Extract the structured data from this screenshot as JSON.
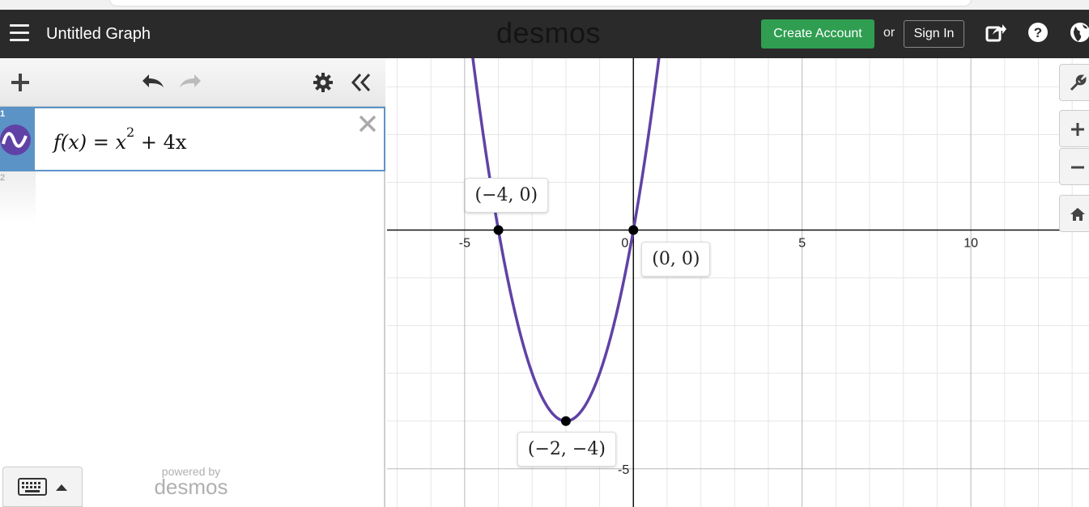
{
  "header": {
    "graph_title": "Untitled Graph",
    "brand": "desmos",
    "create_account_label": "Create Account",
    "or_label": "or",
    "sign_in_label": "Sign In"
  },
  "expressions": [
    {
      "index": "1",
      "latex_parts": {
        "lhs": "f(x) = x",
        "exponent": "2",
        "rhs": "+ 4x"
      },
      "color": "#6042a6"
    },
    {
      "index": "2"
    }
  ],
  "footer": {
    "powered_by": "powered by",
    "brand": "desmos"
  },
  "graph": {
    "curve_color": "#6042a6",
    "x_ticks": [
      "-5",
      "0",
      "5",
      "10"
    ],
    "y_ticks": [
      "-5"
    ],
    "point_labels": [
      "(−4, 0)",
      "(0, 0)",
      "(−2, −4)"
    ]
  },
  "chart_data": {
    "type": "line",
    "title": "",
    "xlabel": "",
    "ylabel": "",
    "function": "x^2 + 4x",
    "xlim": [
      -7.3,
      13.5
    ],
    "ylim": [
      -5.8,
      3.6
    ],
    "grid": true,
    "points": [
      {
        "x": -4,
        "y": 0,
        "label": "(−4, 0)"
      },
      {
        "x": 0,
        "y": 0,
        "label": "(0, 0)"
      },
      {
        "x": -2,
        "y": -4,
        "label": "(−2, −4)"
      }
    ]
  }
}
